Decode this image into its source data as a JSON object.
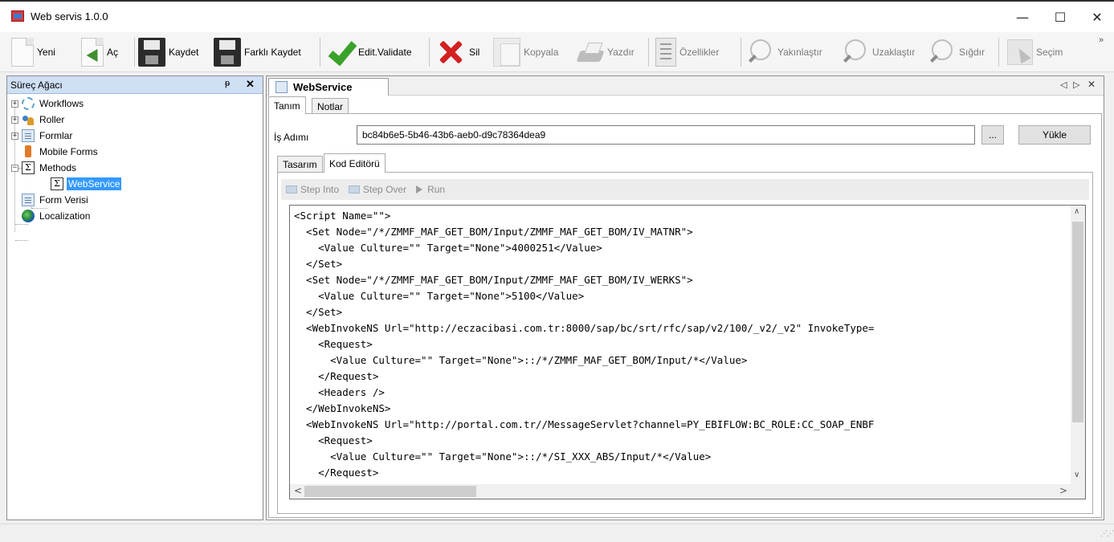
{
  "window": {
    "title": "Web servis 1.0.0",
    "minimize": "—",
    "maximize": "☐",
    "close": "✕"
  },
  "toolbar": {
    "items": [
      {
        "label": "Yeni",
        "icon": "new-document-icon",
        "enabled": true
      },
      {
        "label": "Aç",
        "icon": "open-icon",
        "enabled": true
      },
      {
        "label": "Kaydet",
        "icon": "save-disk-icon",
        "enabled": true
      },
      {
        "label": "Farklı Kaydet",
        "icon": "save-as-disk-icon",
        "enabled": true
      },
      {
        "label": "Edit.Validate",
        "icon": "checkmark-icon",
        "enabled": true
      },
      {
        "label": "Sil",
        "icon": "delete-x-icon",
        "enabled": true
      },
      {
        "label": "Kopyala",
        "icon": "copy-icon",
        "enabled": false
      },
      {
        "label": "Yazdır",
        "icon": "printer-icon",
        "enabled": false
      },
      {
        "label": "Özellikler",
        "icon": "properties-icon",
        "enabled": false
      },
      {
        "label": "Yakınlaştır",
        "icon": "zoom-in-icon",
        "enabled": false
      },
      {
        "label": "Uzaklaştır",
        "icon": "zoom-out-icon",
        "enabled": false
      },
      {
        "label": "Sığdır",
        "icon": "zoom-fit-icon",
        "enabled": false
      },
      {
        "label": "Seçim",
        "icon": "select-cursor-icon",
        "enabled": false
      }
    ],
    "overflow": "»"
  },
  "tree_panel": {
    "title": "Süreç Ağacı",
    "pin": "ᵽ",
    "close": "✕",
    "items": [
      {
        "label": "Workflows",
        "icon": "workflow-gear-icon",
        "toggle": "+"
      },
      {
        "label": "Roller",
        "icon": "users-icon",
        "toggle": "+"
      },
      {
        "label": "Formlar",
        "icon": "form-icon",
        "toggle": "+"
      },
      {
        "label": "Mobile Forms",
        "icon": "mobile-icon",
        "toggle": ""
      },
      {
        "label": "Methods",
        "icon": "sigma-icon",
        "toggle": "−"
      },
      {
        "label": "WebService",
        "icon": "sigma-icon",
        "toggle": "",
        "selected": true
      },
      {
        "label": "Form Verisi",
        "icon": "form-icon",
        "toggle": ""
      },
      {
        "label": "Localization",
        "icon": "globe-icon",
        "toggle": ""
      }
    ]
  },
  "document": {
    "tab_title": "WebService",
    "tab_nav_left": "◁",
    "tab_nav_right": "▷",
    "tab_close": "✕",
    "outer_tabs": [
      {
        "label": "Tanım",
        "active": true
      },
      {
        "label": "Notlar",
        "active": false
      }
    ],
    "field_label": "İş Adımı",
    "field_value": "bc84b6e5-5b46-43b6-aeb0-d9c78364dea9",
    "browse_label": "...",
    "load_label": "Yükle",
    "inner_tabs": [
      {
        "label": "Tasarım",
        "active": false
      },
      {
        "label": "Kod Editörü",
        "active": true
      }
    ],
    "debug": {
      "step_into": "Step Into",
      "step_over": "Step Over",
      "run": "Run"
    },
    "code_lines": [
      "<Script Name=\"\">",
      "  <Set Node=\"/*/ZMMF_MAF_GET_BOM/Input/ZMMF_MAF_GET_BOM/IV_MATNR\">",
      "    <Value Culture=\"\" Target=\"None\">4000251</Value>",
      "  </Set>",
      "  <Set Node=\"/*/ZMMF_MAF_GET_BOM/Input/ZMMF_MAF_GET_BOM/IV_WERKS\">",
      "    <Value Culture=\"\" Target=\"None\">5100</Value>",
      "  </Set>",
      "  <WebInvokeNS Url=\"http://eczacibasi.com.tr:8000/sap/bc/srt/rfc/sap/v2/100/_v2/_v2\" InvokeType=",
      "    <Request>",
      "      <Value Culture=\"\" Target=\"None\">::/*/ZMMF_MAF_GET_BOM/Input/*</Value>",
      "    </Request>",
      "    <Headers />",
      "  </WebInvokeNS>",
      "  <WebInvokeNS Url=\"http://portal.com.tr//MessageServlet?channel=PY_EBIFLOW:BC_ROLE:CC_SOAP_ENBF",
      "    <Request>",
      "      <Value Culture=\"\" Target=\"None\">::/*/SI_XXX_ABS/Input/*</Value>",
      "    </Request>"
    ],
    "scroll": {
      "up": "∧",
      "down": "∨",
      "left": "<",
      "right": ">"
    }
  },
  "colors": {
    "panel_header": "#cfe0f5",
    "selection": "#3399ff",
    "validate_green": "#3aa22a",
    "delete_red": "#d32020"
  }
}
